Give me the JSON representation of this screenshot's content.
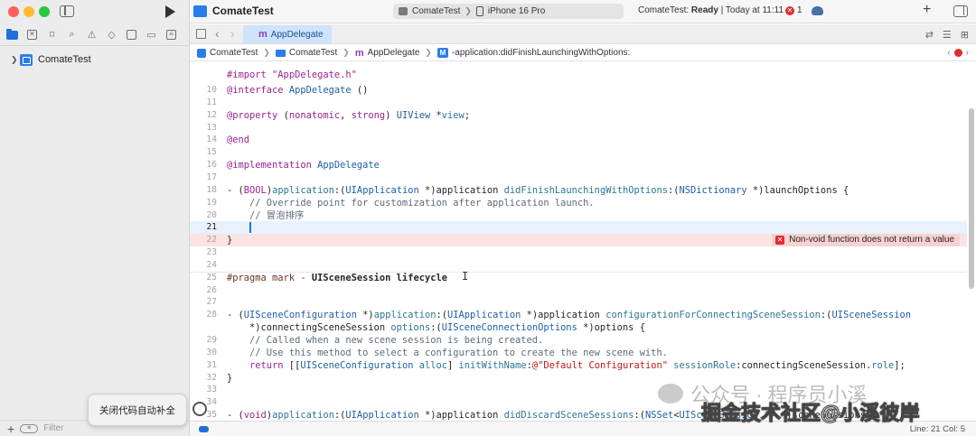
{
  "window": {
    "project_title": "ComateTest"
  },
  "sidebar": {
    "project_item": "ComateTest",
    "filter_placeholder": "Filter"
  },
  "toolbar": {
    "scheme": "ComateTest",
    "device": "iPhone 16 Pro",
    "status_prefix": "ComateTest: ",
    "status_state": "Ready",
    "status_suffix": " | Today at 11:11",
    "error_count": "1"
  },
  "tabs": [
    {
      "label": "AppDelegate"
    }
  ],
  "jumpbar": {
    "items": [
      "ComateTest",
      "ComateTest",
      "AppDelegate",
      "-application:didFinishLaunchingWithOptions:"
    ]
  },
  "editor": {
    "top_partial": "#import \"AppDelegate.h\"",
    "lines": [
      {
        "n": "10",
        "segs": [
          [
            "kw",
            "@interface"
          ],
          [
            "",
            " "
          ],
          [
            "ty",
            "AppDelegate"
          ],
          [
            "",
            " ()"
          ]
        ]
      },
      {
        "n": "11",
        "segs": []
      },
      {
        "n": "12",
        "segs": [
          [
            "kw",
            "@property"
          ],
          [
            "",
            " ("
          ],
          [
            "kw",
            "nonatomic"
          ],
          [
            "",
            ", "
          ],
          [
            "kw",
            "strong"
          ],
          [
            "",
            ") "
          ],
          [
            "ty",
            "UIView"
          ],
          [
            "",
            " *"
          ],
          [
            "fn",
            "view"
          ],
          [
            "",
            ";"
          ]
        ]
      },
      {
        "n": "13",
        "segs": []
      },
      {
        "n": "14",
        "segs": [
          [
            "kw",
            "@end"
          ]
        ]
      },
      {
        "n": "15",
        "segs": []
      },
      {
        "n": "16",
        "segs": [
          [
            "kw",
            "@implementation"
          ],
          [
            "",
            " "
          ],
          [
            "ty",
            "AppDelegate"
          ]
        ]
      },
      {
        "n": "17",
        "segs": []
      },
      {
        "n": "18",
        "segs": [
          [
            "",
            "- ("
          ],
          [
            "kw",
            "BOOL"
          ],
          [
            "",
            ")"
          ],
          [
            "fn",
            "application"
          ],
          [
            "",
            ":("
          ],
          [
            "ty",
            "UIApplication"
          ],
          [
            "",
            " *)application "
          ],
          [
            "fn",
            "didFinishLaunchingWithOptions"
          ],
          [
            "",
            ":("
          ],
          [
            "ty",
            "NSDictionary"
          ],
          [
            "",
            " *)launchOptions {"
          ]
        ]
      },
      {
        "n": "19",
        "segs": [
          [
            "cm",
            "    // Override point for customization after application launch."
          ]
        ]
      },
      {
        "n": "20",
        "segs": [
          [
            "cm",
            "    // 冒泡排序"
          ]
        ]
      },
      {
        "n": "21",
        "segs": [
          [
            "",
            "    "
          ]
        ],
        "cursor": true
      },
      {
        "n": "22",
        "segs": [
          [
            "",
            "}"
          ]
        ],
        "error": true
      },
      {
        "n": "23",
        "segs": []
      },
      {
        "n": "24",
        "segs": []
      },
      {
        "n": "25",
        "segs": [
          [
            "pm",
            "#pragma mark - "
          ],
          [
            "bold",
            "UISceneSession lifecycle"
          ]
        ]
      },
      {
        "n": "26",
        "segs": []
      },
      {
        "n": "27",
        "segs": []
      },
      {
        "n": "28",
        "segs": [
          [
            "",
            "- ("
          ],
          [
            "ty",
            "UISceneConfiguration"
          ],
          [
            "",
            " *)"
          ],
          [
            "fn",
            "application"
          ],
          [
            "",
            ":("
          ],
          [
            "ty",
            "UIApplication"
          ],
          [
            "",
            " *)application "
          ],
          [
            "fn",
            "configurationForConnectingSceneSession"
          ],
          [
            "",
            ":("
          ],
          [
            "ty",
            "UISceneSession"
          ]
        ]
      },
      {
        "n": "",
        "segs": [
          [
            "",
            "    *)connectingSceneSession "
          ],
          [
            "fn",
            "options"
          ],
          [
            "",
            ":("
          ],
          [
            "ty",
            "UISceneConnectionOptions"
          ],
          [
            "",
            " *)options {"
          ]
        ]
      },
      {
        "n": "29",
        "segs": [
          [
            "cm",
            "    // Called when a new scene session is being created."
          ]
        ]
      },
      {
        "n": "30",
        "segs": [
          [
            "cm",
            "    // Use this method to select a configuration to create the new scene with."
          ]
        ]
      },
      {
        "n": "31",
        "segs": [
          [
            "",
            "    "
          ],
          [
            "kw",
            "return"
          ],
          [
            "",
            " [["
          ],
          [
            "ty",
            "UISceneConfiguration"
          ],
          [
            "",
            " "
          ],
          [
            "fn",
            "alloc"
          ],
          [
            "",
            "] "
          ],
          [
            "fn",
            "initWithName"
          ],
          [
            "",
            ":"
          ],
          [
            "str",
            "@\"Default Configuration\""
          ],
          [
            "",
            " "
          ],
          [
            "fn",
            "sessionRole"
          ],
          [
            "",
            ":connectingSceneSession."
          ],
          [
            "fn",
            "role"
          ],
          [
            "",
            "];"
          ]
        ]
      },
      {
        "n": "32",
        "segs": [
          [
            "",
            "}"
          ]
        ]
      },
      {
        "n": "33",
        "segs": []
      },
      {
        "n": "34",
        "segs": []
      },
      {
        "n": "35",
        "segs": [
          [
            "",
            "- ("
          ],
          [
            "kw",
            "void"
          ],
          [
            "",
            ")"
          ],
          [
            "fn",
            "application"
          ],
          [
            "",
            ":("
          ],
          [
            "ty",
            "UIApplication"
          ],
          [
            "",
            " *)application "
          ],
          [
            "fn",
            "didDiscardSceneSessions"
          ],
          [
            "",
            ":("
          ],
          [
            "ty",
            "NSSet"
          ],
          [
            "",
            "<"
          ],
          [
            "ty",
            "UISceneSession"
          ],
          [
            "",
            " *> *)sceneSessions {"
          ]
        ]
      }
    ],
    "error_message": "Non-void function does not return a value"
  },
  "tooltip": {
    "text": "关闭代码自动补全"
  },
  "statusbar": {
    "position": "Line: 21  Col: 5"
  },
  "watermark": {
    "line1": "公众号 · 程序员小溪",
    "line2": "掘金技术社区@小溪彼岸"
  },
  "colors": {
    "accent": "#1e6fd9",
    "error": "#e02d2d",
    "keyword": "#9b2393",
    "type": "#1f5fa6",
    "comment": "#5d6c79"
  }
}
